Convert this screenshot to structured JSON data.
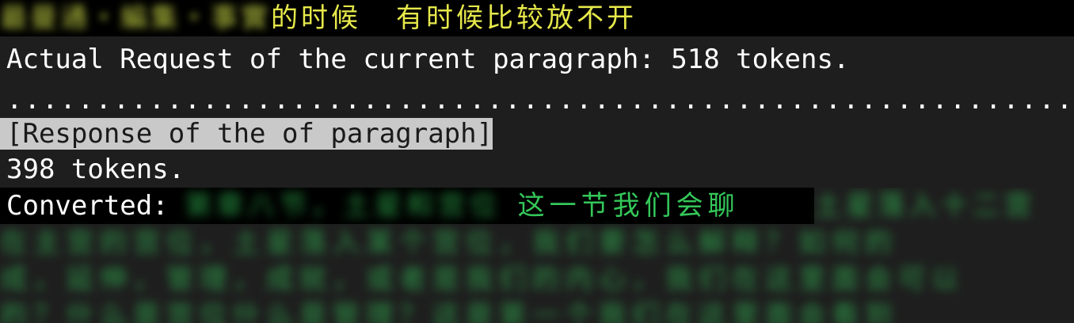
{
  "terminal": {
    "line1": {
      "blurred_prefix": "最曼通・編集・事實",
      "visible_text": "的时候",
      "visible_text_2": "有时候比较放不开"
    },
    "line2": {
      "text": "Actual Request of the current paragraph: 518 tokens."
    },
    "line3": {
      "text": "........................................................................"
    },
    "line4": {
      "text": "[Response of the of paragraph]"
    },
    "line5": {
      "text": "398 tokens."
    },
    "line6": {
      "label": "Converted:",
      "blurred_before": "第章八节，土星和宫位",
      "visible_text": "这一节我们会聊",
      "blurred_after": "土星落入十二宫"
    },
    "blurred_lines": [
      "在主宫的宫位，土星落入某个宫位，我们要怎么解释？如何的",
      "成，延伸，管理，成就，或者是我们的内心，我们在这里面会可以",
      "的？什么是宫位什么是管理？这是第一个我们在这里面会看到"
    ]
  }
}
